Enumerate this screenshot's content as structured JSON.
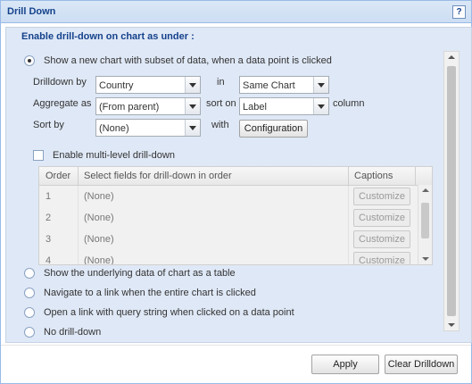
{
  "window": {
    "title": "Drill Down",
    "help_label": "?"
  },
  "section": {
    "heading": "Enable drill-down on chart as under :",
    "option_new_chart": "Show a new chart with subset of data, when a data point is clicked",
    "drilldown_by_label": "Drilldown by",
    "drilldown_by_value": "Country",
    "in_label": "in",
    "in_value": "Same Chart",
    "aggregate_label": "Aggregate as",
    "aggregate_value": "(From parent)",
    "sort_on_label": "sort on",
    "sort_on_value": "Label",
    "column_label": "column",
    "sort_by_label": "Sort by",
    "sort_by_value": "(None)",
    "with_label": "with",
    "configuration_button": "Configuration",
    "multilevel_label": "Enable multi-level drill-down",
    "grid": {
      "headers": [
        "Order",
        "Select fields for drill-down in order",
        "Captions"
      ],
      "rows": [
        {
          "order": "1",
          "field": "(None)",
          "button": "Customize"
        },
        {
          "order": "2",
          "field": "(None)",
          "button": "Customize"
        },
        {
          "order": "3",
          "field": "(None)",
          "button": "Customize"
        },
        {
          "order": "4",
          "field": "(None)",
          "button": "Customize"
        }
      ]
    },
    "option_table": "Show the underlying data of chart as a table",
    "option_link_chart": "Navigate to a link when the entire chart is clicked",
    "option_link_point": "Open a link with query string when clicked on a data point",
    "option_no_drill": "No drill-down"
  },
  "footer": {
    "apply_button": "Apply",
    "clear_button": "Clear Drilldown"
  },
  "colors": {
    "accent": "#15428b",
    "panel": "#dfe8f6",
    "border": "#99bbe8"
  }
}
